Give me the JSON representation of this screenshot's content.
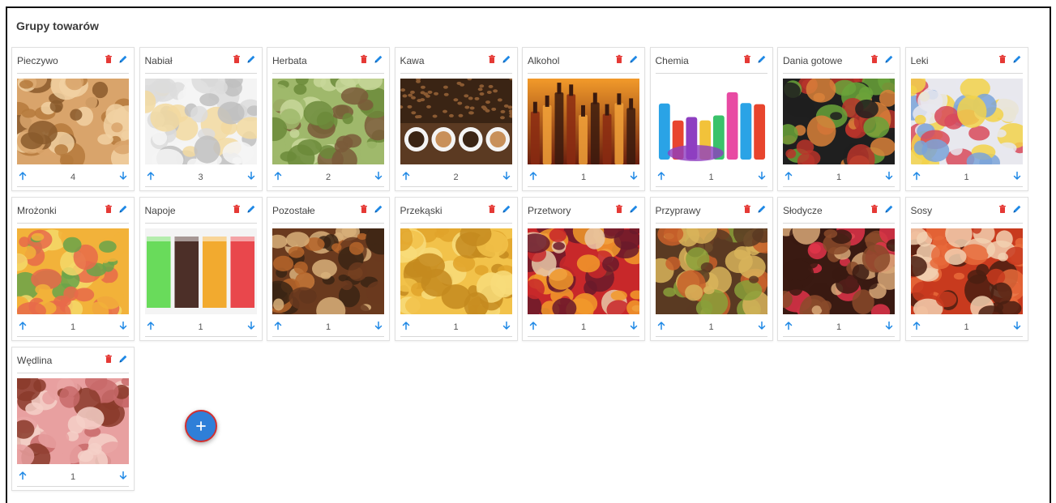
{
  "panel": {
    "title": "Grupy towarów"
  },
  "colors": {
    "delete": "#e53935",
    "edit": "#1e88e5",
    "arrow": "#1e88e5",
    "fab": "#2f7fd8",
    "fab_border": "#d32f2f"
  },
  "icons": {
    "delete": "trash-icon",
    "edit": "pencil-icon",
    "up": "arrow-up-icon",
    "down": "arrow-down-icon",
    "add": "plus-icon"
  },
  "groups": [
    {
      "name": "Pieczywo",
      "count": "4",
      "image": "bread",
      "palette": [
        "#d9a46b",
        "#b57a3c",
        "#f1d1a2",
        "#8a5a2b"
      ]
    },
    {
      "name": "Nabiał",
      "count": "3",
      "image": "dairy",
      "palette": [
        "#f4f4f4",
        "#dcdcdc",
        "#f2d9a0",
        "#bfbfbf"
      ]
    },
    {
      "name": "Herbata",
      "count": "2",
      "image": "tea",
      "palette": [
        "#9fb86b",
        "#6b8a3a",
        "#c8d79a",
        "#7a5a3a"
      ]
    },
    {
      "name": "Kawa",
      "count": "2",
      "image": "coffee",
      "palette": [
        "#5b3a22",
        "#8a5a32",
        "#f0e6d8",
        "#3a2414"
      ]
    },
    {
      "name": "Alkohol",
      "count": "1",
      "image": "alcohol",
      "palette": [
        "#e06a1e",
        "#8a2a12",
        "#f2a23a",
        "#3a1a0e"
      ]
    },
    {
      "name": "Chemia",
      "count": "1",
      "image": "chemicals",
      "palette": [
        "#ffffff",
        "#2aa3e6",
        "#e8452e",
        "#8e3fc1"
      ]
    },
    {
      "name": "Dania gotowe",
      "count": "1",
      "image": "meals",
      "palette": [
        "#1f1f1f",
        "#d9813a",
        "#6aa33a",
        "#b8342a"
      ]
    },
    {
      "name": "Leki",
      "count": "1",
      "image": "pills",
      "palette": [
        "#e8e8ee",
        "#d84a5a",
        "#f2d24a",
        "#7aa3d8"
      ]
    },
    {
      "name": "Mrożonki",
      "count": "1",
      "image": "frozen",
      "palette": [
        "#f2b23a",
        "#e86a4a",
        "#6aa34a",
        "#f4d86a"
      ]
    },
    {
      "name": "Napoje",
      "count": "1",
      "image": "drinks",
      "palette": [
        "#5ad84a",
        "#3a1a12",
        "#f2a21a",
        "#e8343a"
      ]
    },
    {
      "name": "Pozostałe",
      "count": "1",
      "image": "misc",
      "palette": [
        "#6a3a1e",
        "#b5652a",
        "#d8b07a",
        "#3a2414"
      ]
    },
    {
      "name": "Przekąski",
      "count": "1",
      "image": "chips",
      "palette": [
        "#f2c24a",
        "#e0a32a",
        "#f8dc7a",
        "#c48a1e"
      ]
    },
    {
      "name": "Przetwory",
      "count": "1",
      "image": "preserves",
      "palette": [
        "#c8282a",
        "#f29a2a",
        "#6a1a2a",
        "#e8c8a8"
      ]
    },
    {
      "name": "Przyprawy",
      "count": "1",
      "image": "spices",
      "palette": [
        "#5a3a22",
        "#c8602a",
        "#8aa03a",
        "#d8b45a"
      ]
    },
    {
      "name": "Słodycze",
      "count": "1",
      "image": "sweets",
      "palette": [
        "#3a1a12",
        "#8a4a2a",
        "#e0344a",
        "#d8a878"
      ]
    },
    {
      "name": "Sosy",
      "count": "1",
      "image": "sauces",
      "palette": [
        "#c83a1e",
        "#e86a3a",
        "#4a1e12",
        "#f2d0b0"
      ]
    },
    {
      "name": "Wędlina",
      "count": "1",
      "image": "ham",
      "palette": [
        "#e8a0a0",
        "#c86a6a",
        "#f4d0c8",
        "#8a3a2a"
      ]
    }
  ],
  "fab": {
    "label": "+"
  }
}
